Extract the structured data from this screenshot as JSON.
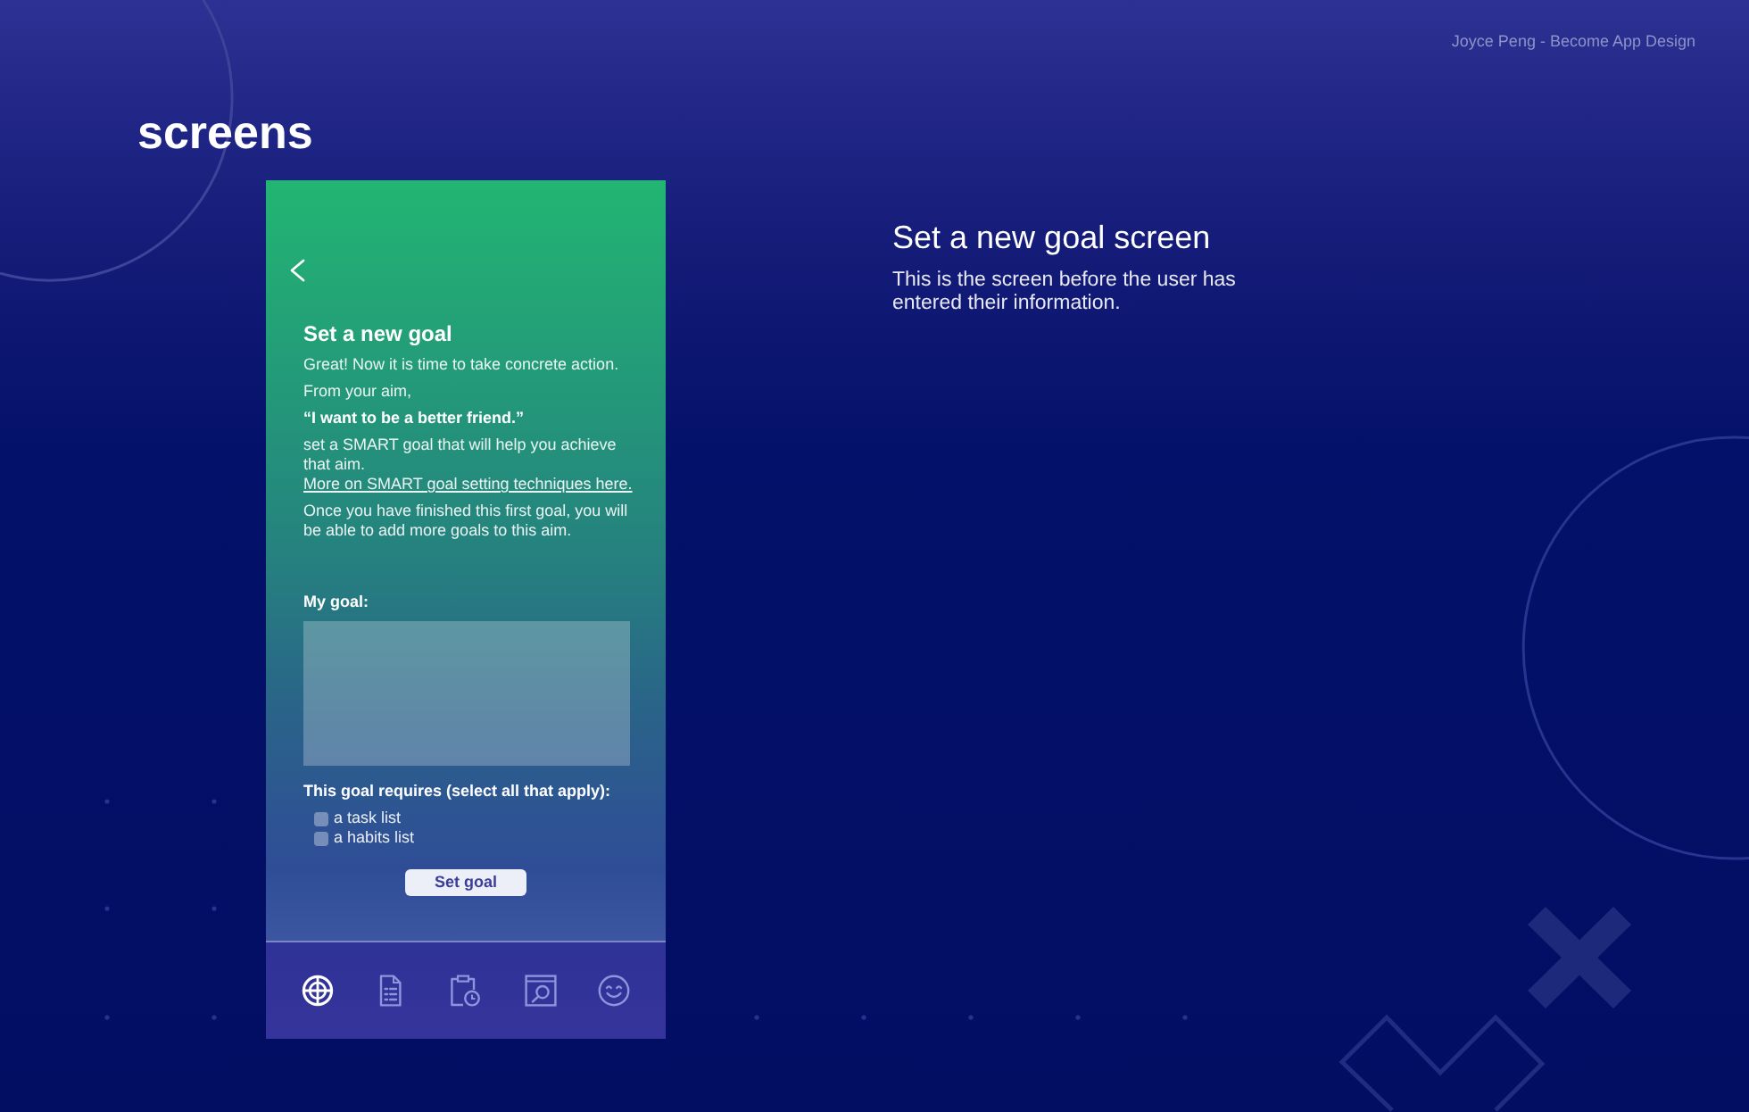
{
  "credit": "Joyce Peng - Become App Design",
  "section_title": "screens",
  "phone": {
    "title": "Set a new goal",
    "paragraphs": [
      {
        "kind": "text",
        "text": "Great! Now it is time to take concrete action."
      },
      {
        "kind": "text",
        "text": "From your aim,"
      },
      {
        "kind": "quote",
        "text": "“I want to be a better friend.”"
      },
      {
        "kind": "text",
        "text": "set a SMART goal that will help you achieve that aim.",
        "link": "More on SMART goal setting techniques here."
      },
      {
        "kind": "text",
        "text": "Once you have finished this first goal, you will be able to add more goals to this aim."
      }
    ],
    "goal_label": "My goal:",
    "requirements_label": "This goal requires (select all that apply):",
    "options": [
      {
        "label": "a task list",
        "checked": false
      },
      {
        "label": "a habits list",
        "checked": false
      }
    ],
    "button": "Set goal",
    "nav_tabs": [
      {
        "selected": true
      },
      {
        "selected": false
      },
      {
        "selected": false
      },
      {
        "selected": false
      },
      {
        "selected": false
      }
    ]
  },
  "description": {
    "title": "Set a new goal screen",
    "text": "This is the screen before the user has entered their information."
  }
}
